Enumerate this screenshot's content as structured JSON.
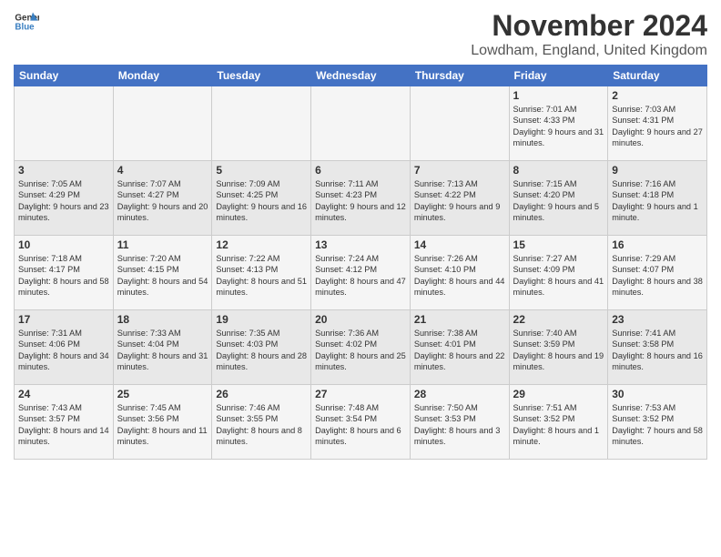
{
  "header": {
    "logo_line1": "General",
    "logo_line2": "Blue",
    "month": "November 2024",
    "location": "Lowdham, England, United Kingdom"
  },
  "weekdays": [
    "Sunday",
    "Monday",
    "Tuesday",
    "Wednesday",
    "Thursday",
    "Friday",
    "Saturday"
  ],
  "rows": [
    [
      {
        "day": "",
        "text": ""
      },
      {
        "day": "",
        "text": ""
      },
      {
        "day": "",
        "text": ""
      },
      {
        "day": "",
        "text": ""
      },
      {
        "day": "",
        "text": ""
      },
      {
        "day": "1",
        "text": "Sunrise: 7:01 AM\nSunset: 4:33 PM\nDaylight: 9 hours and 31 minutes."
      },
      {
        "day": "2",
        "text": "Sunrise: 7:03 AM\nSunset: 4:31 PM\nDaylight: 9 hours and 27 minutes."
      }
    ],
    [
      {
        "day": "3",
        "text": "Sunrise: 7:05 AM\nSunset: 4:29 PM\nDaylight: 9 hours and 23 minutes."
      },
      {
        "day": "4",
        "text": "Sunrise: 7:07 AM\nSunset: 4:27 PM\nDaylight: 9 hours and 20 minutes."
      },
      {
        "day": "5",
        "text": "Sunrise: 7:09 AM\nSunset: 4:25 PM\nDaylight: 9 hours and 16 minutes."
      },
      {
        "day": "6",
        "text": "Sunrise: 7:11 AM\nSunset: 4:23 PM\nDaylight: 9 hours and 12 minutes."
      },
      {
        "day": "7",
        "text": "Sunrise: 7:13 AM\nSunset: 4:22 PM\nDaylight: 9 hours and 9 minutes."
      },
      {
        "day": "8",
        "text": "Sunrise: 7:15 AM\nSunset: 4:20 PM\nDaylight: 9 hours and 5 minutes."
      },
      {
        "day": "9",
        "text": "Sunrise: 7:16 AM\nSunset: 4:18 PM\nDaylight: 9 hours and 1 minute."
      }
    ],
    [
      {
        "day": "10",
        "text": "Sunrise: 7:18 AM\nSunset: 4:17 PM\nDaylight: 8 hours and 58 minutes."
      },
      {
        "day": "11",
        "text": "Sunrise: 7:20 AM\nSunset: 4:15 PM\nDaylight: 8 hours and 54 minutes."
      },
      {
        "day": "12",
        "text": "Sunrise: 7:22 AM\nSunset: 4:13 PM\nDaylight: 8 hours and 51 minutes."
      },
      {
        "day": "13",
        "text": "Sunrise: 7:24 AM\nSunset: 4:12 PM\nDaylight: 8 hours and 47 minutes."
      },
      {
        "day": "14",
        "text": "Sunrise: 7:26 AM\nSunset: 4:10 PM\nDaylight: 8 hours and 44 minutes."
      },
      {
        "day": "15",
        "text": "Sunrise: 7:27 AM\nSunset: 4:09 PM\nDaylight: 8 hours and 41 minutes."
      },
      {
        "day": "16",
        "text": "Sunrise: 7:29 AM\nSunset: 4:07 PM\nDaylight: 8 hours and 38 minutes."
      }
    ],
    [
      {
        "day": "17",
        "text": "Sunrise: 7:31 AM\nSunset: 4:06 PM\nDaylight: 8 hours and 34 minutes."
      },
      {
        "day": "18",
        "text": "Sunrise: 7:33 AM\nSunset: 4:04 PM\nDaylight: 8 hours and 31 minutes."
      },
      {
        "day": "19",
        "text": "Sunrise: 7:35 AM\nSunset: 4:03 PM\nDaylight: 8 hours and 28 minutes."
      },
      {
        "day": "20",
        "text": "Sunrise: 7:36 AM\nSunset: 4:02 PM\nDaylight: 8 hours and 25 minutes."
      },
      {
        "day": "21",
        "text": "Sunrise: 7:38 AM\nSunset: 4:01 PM\nDaylight: 8 hours and 22 minutes."
      },
      {
        "day": "22",
        "text": "Sunrise: 7:40 AM\nSunset: 3:59 PM\nDaylight: 8 hours and 19 minutes."
      },
      {
        "day": "23",
        "text": "Sunrise: 7:41 AM\nSunset: 3:58 PM\nDaylight: 8 hours and 16 minutes."
      }
    ],
    [
      {
        "day": "24",
        "text": "Sunrise: 7:43 AM\nSunset: 3:57 PM\nDaylight: 8 hours and 14 minutes."
      },
      {
        "day": "25",
        "text": "Sunrise: 7:45 AM\nSunset: 3:56 PM\nDaylight: 8 hours and 11 minutes."
      },
      {
        "day": "26",
        "text": "Sunrise: 7:46 AM\nSunset: 3:55 PM\nDaylight: 8 hours and 8 minutes."
      },
      {
        "day": "27",
        "text": "Sunrise: 7:48 AM\nSunset: 3:54 PM\nDaylight: 8 hours and 6 minutes."
      },
      {
        "day": "28",
        "text": "Sunrise: 7:50 AM\nSunset: 3:53 PM\nDaylight: 8 hours and 3 minutes."
      },
      {
        "day": "29",
        "text": "Sunrise: 7:51 AM\nSunset: 3:52 PM\nDaylight: 8 hours and 1 minute."
      },
      {
        "day": "30",
        "text": "Sunrise: 7:53 AM\nSunset: 3:52 PM\nDaylight: 7 hours and 58 minutes."
      }
    ]
  ]
}
